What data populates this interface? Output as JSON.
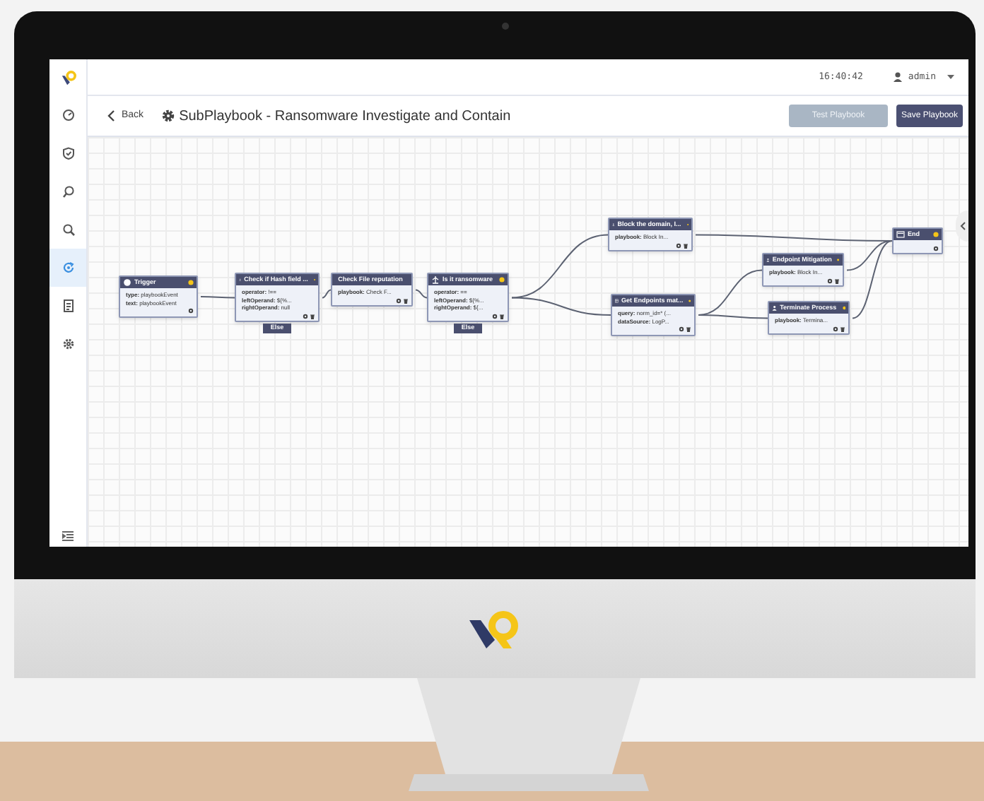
{
  "top_bar": {
    "time": "16:40:42",
    "user": "admin"
  },
  "header": {
    "back": "Back",
    "title": "SubPlaybook - Ransomware Investigate and Contain",
    "buttons": [
      {
        "label": "Test Playbook",
        "disabled": true
      },
      {
        "label": "Save Playbook",
        "disabled": false
      }
    ]
  },
  "sidebar": {
    "items": [
      {
        "selected": false
      },
      {
        "selected": false
      },
      {
        "selected": false
      },
      {
        "selected": false
      },
      {
        "selected": true
      },
      {
        "selected": false
      },
      {
        "selected": false
      }
    ]
  },
  "nodes": [
    {
      "kind": "trigger",
      "title": "Trigger",
      "fields": [
        {
          "key": "type:",
          "value": "playbookEvent"
        },
        {
          "key": "text:",
          "value": "playbookEvent"
        }
      ]
    },
    {
      "kind": "condition",
      "title": "Check if Hash field ...",
      "fields": [
        {
          "key": "operator:",
          "value": "!=="
        },
        {
          "key": "leftOperand:",
          "value": "${%..."
        },
        {
          "key": "rightOperand:",
          "value": "null"
        }
      ],
      "else": "Else"
    },
    {
      "kind": "task",
      "title": "Check File reputation",
      "fields": [
        {
          "key": "playbook:",
          "value": "Check F..."
        }
      ]
    },
    {
      "kind": "condition",
      "title": "Is it ransomware",
      "fields": [
        {
          "key": "operator:",
          "value": "=="
        },
        {
          "key": "leftOperand:",
          "value": "${%..."
        },
        {
          "key": "rightOperand:",
          "value": "${..."
        }
      ],
      "else": "Else"
    },
    {
      "kind": "task",
      "title": "Block the domain, I...",
      "fields": [
        {
          "key": "playbook:",
          "value": "Block In..."
        }
      ]
    },
    {
      "kind": "query",
      "title": "Get Endpoints mat...",
      "fields": [
        {
          "key": "query:",
          "value": "norm_id=* (..."
        },
        {
          "key": "dataSource:",
          "value": "LogP..."
        }
      ]
    },
    {
      "kind": "task",
      "title": "Endpoint Mitigation",
      "fields": [
        {
          "key": "playbook:",
          "value": "Block In..."
        }
      ]
    },
    {
      "kind": "task",
      "title": "Terminate Process",
      "fields": [
        {
          "key": "playbook:",
          "value": "Termina..."
        }
      ]
    },
    {
      "kind": "end",
      "title": "End"
    }
  ]
}
